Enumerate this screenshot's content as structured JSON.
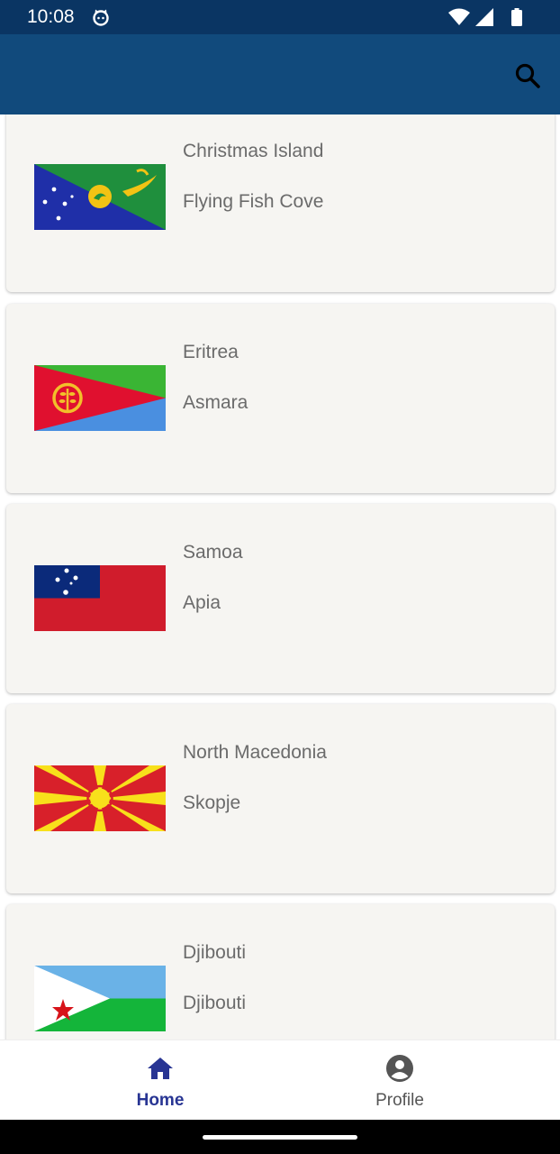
{
  "status_bar": {
    "time": "10:08",
    "icons": [
      "cat-notification-icon",
      "wifi-icon",
      "cellular-signal-icon",
      "battery-icon"
    ]
  },
  "app_bar": {
    "actions": [
      {
        "icon": "search-icon"
      }
    ],
    "colors": {
      "status_bar": "#0a3563",
      "app_bar": "#114a7c"
    }
  },
  "countries": [
    {
      "name": "Christmas Island",
      "capital": "Flying Fish Cove",
      "flag": "christmas-island-flag"
    },
    {
      "name": "Eritrea",
      "capital": "Asmara",
      "flag": "eritrea-flag"
    },
    {
      "name": "Samoa",
      "capital": "Apia",
      "flag": "samoa-flag"
    },
    {
      "name": "North Macedonia",
      "capital": "Skopje",
      "flag": "north-macedonia-flag"
    },
    {
      "name": "Djibouti",
      "capital": "Djibouti",
      "flag": "djibouti-flag"
    }
  ],
  "bottom_nav": {
    "items": [
      {
        "label": "Home",
        "icon": "home-icon",
        "selected": true
      },
      {
        "label": "Profile",
        "icon": "account-circle-icon",
        "selected": false
      }
    ],
    "active_color": "#283593"
  }
}
